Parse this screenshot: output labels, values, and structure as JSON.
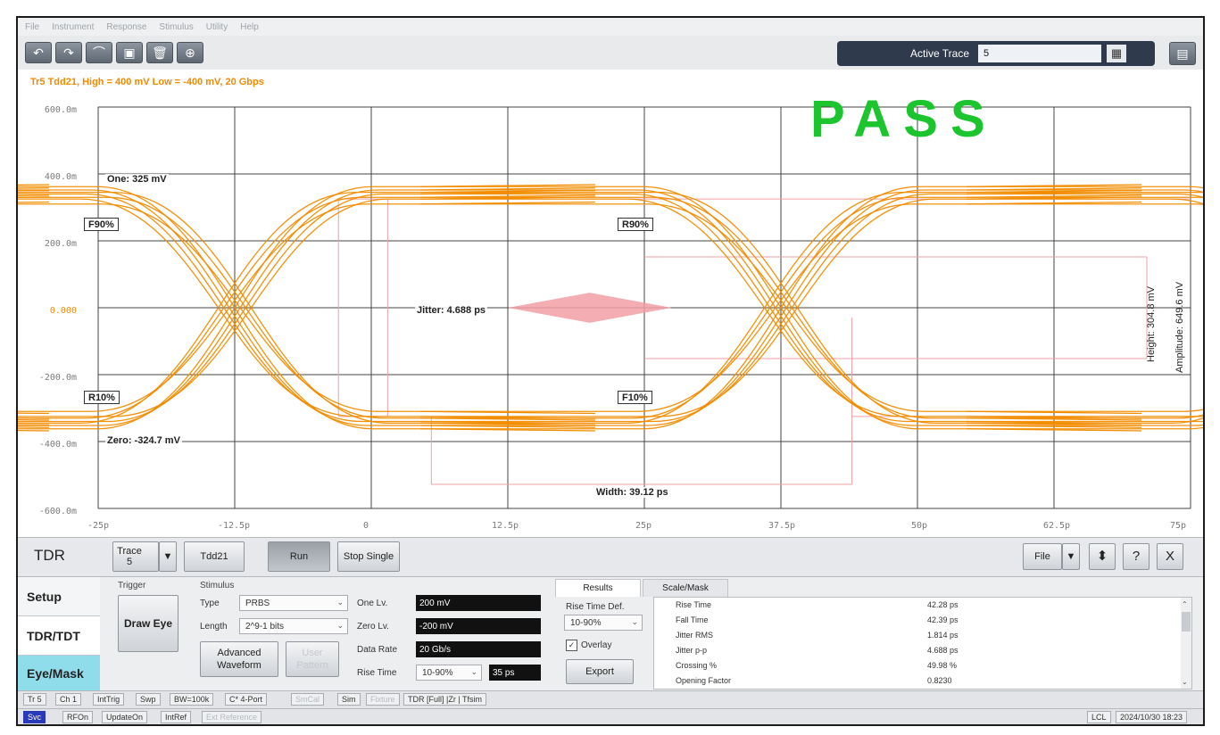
{
  "menu": [
    "File",
    "Instrument",
    "Response",
    "Stimulus",
    "Utility",
    "Help"
  ],
  "toolbar": {
    "buttons": [
      "undo-icon",
      "redo-icon",
      "marker-icon",
      "screenshot-icon",
      "trash-icon",
      "zoom-icon"
    ],
    "active_trace_label": "Active Trace",
    "active_trace_value": "5"
  },
  "plot": {
    "trace_header": "Tr5 Tdd21, High = 400 mV Low = -400 mV, 20 Gbps",
    "y_ticks": [
      "600.0m",
      "400.0m",
      "200.0m",
      "0.000",
      "-200.0m",
      "-400.0m",
      "-600.0m"
    ],
    "x_ticks": [
      "-25p",
      "-12.5p",
      "0",
      "12.5p",
      "25p",
      "37.5p",
      "50p",
      "62.5p",
      "75p"
    ],
    "pass_text": "PASS",
    "one_level": "One: 325 mV",
    "zero_level": "Zero: -324.7 mV",
    "f90": "F90%",
    "r90": "R90%",
    "r10": "R10%",
    "f10": "F10%",
    "jitter": "Jitter: 4.688 ps",
    "width": "Width: 39.12 ps",
    "height": "Height: 304.8 mV",
    "amplitude": "Amplitude: 649.6 mV",
    "colors": {
      "trace": "#f28c00",
      "mask": "#f2a0a6",
      "pass": "#1cc42d"
    }
  },
  "controls": {
    "mode": "TDR",
    "trace_btn": "Trace 5",
    "tdd21_btn": "Tdd21",
    "run_btn": "Run",
    "stop_single_btn": "Stop Single",
    "file_btn": "File",
    "help_btn": "?",
    "close_btn": "X"
  },
  "side_tabs": [
    "Setup",
    "TDR/TDT",
    "Eye/Mask"
  ],
  "trigger": {
    "title": "Trigger",
    "draw_eye": "Draw Eye"
  },
  "stimulus": {
    "title": "Stimulus",
    "type_label": "Type",
    "type_value": "PRBS",
    "length_label": "Length",
    "length_value": "2^9-1 bits",
    "advanced_waveform": "Advanced Waveform",
    "user_pattern": "User Pattern",
    "one_lv_label": "One Lv.",
    "one_lv_value": "200 mV",
    "zero_lv_label": "Zero Lv.",
    "zero_lv_value": "-200 mV",
    "data_rate_label": "Data Rate",
    "data_rate_value": "20 Gb/s",
    "rise_time_label": "Rise Time",
    "rise_time_def": "10-90%",
    "rise_time_value": "35 ps"
  },
  "results_panel": {
    "tab_results": "Results",
    "tab_scale_mask": "Scale/Mask",
    "rise_time_def_label": "Rise Time Def.",
    "rise_time_def_value": "10-90%",
    "overlay_label": "Overlay",
    "export_btn": "Export",
    "rows": [
      {
        "name": "Rise Time",
        "value": "42.28 ps"
      },
      {
        "name": "Fall Time",
        "value": "42.39 ps"
      },
      {
        "name": "Jitter RMS",
        "value": "1.814 ps"
      },
      {
        "name": "Jitter p-p",
        "value": "4.688 ps"
      },
      {
        "name": "Crossing %",
        "value": "49.98 %"
      },
      {
        "name": "Opening Factor",
        "value": "0.8230"
      }
    ]
  },
  "status1": [
    "Tr 5",
    "Ch 1",
    "IntTrig",
    "Swp",
    "BW=100k",
    "C* 4-Port",
    "SmCal",
    "Sim",
    "Fixture",
    "TDR [Full] |Zr | Tfsim"
  ],
  "status2": {
    "left": [
      "Svc",
      "RFOn",
      "UpdateOn",
      "IntRef",
      "Ext Reference"
    ],
    "right": [
      "LCL",
      "2024/10/30 18:23"
    ]
  }
}
